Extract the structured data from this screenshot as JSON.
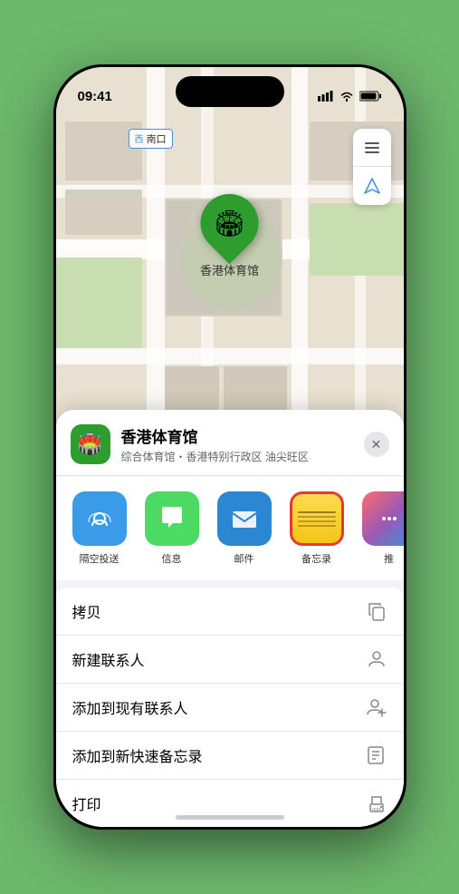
{
  "status_bar": {
    "time": "09:41",
    "location_icon": "▶",
    "signal_bars": "▌▌▌",
    "wifi_icon": "wifi",
    "battery_icon": "battery"
  },
  "map": {
    "label": "南口",
    "location_name": "香港体育馆",
    "location_subtitle": "综合体育馆・香港特别行政区 油尖旺区"
  },
  "map_controls": {
    "layers_icon": "map",
    "location_icon": "arrow"
  },
  "share_actions": {
    "airdrop": {
      "label": "隔空投送",
      "icon": "📡"
    },
    "message": {
      "label": "信息",
      "icon": "💬"
    },
    "mail": {
      "label": "邮件",
      "icon": "✉️"
    },
    "notes": {
      "label": "备忘录",
      "icon": "📝"
    },
    "more": {
      "label": "推",
      "icon": "⋯"
    }
  },
  "action_items": [
    {
      "label": "拷贝",
      "icon": "copy"
    },
    {
      "label": "新建联系人",
      "icon": "person"
    },
    {
      "label": "添加到现有联系人",
      "icon": "person-add"
    },
    {
      "label": "添加到新快速备忘录",
      "icon": "note-add"
    },
    {
      "label": "打印",
      "icon": "print"
    }
  ],
  "close_btn_label": "✕",
  "venue_icon": "🏟️"
}
